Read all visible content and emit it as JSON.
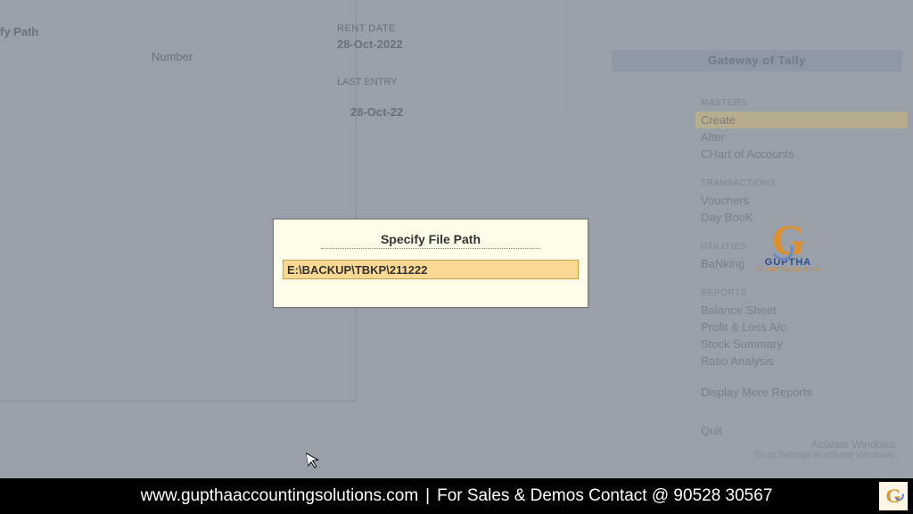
{
  "left": {
    "specify_path_label": "fy Path",
    "number_label": "Number"
  },
  "dates": {
    "current_label": "RENT DATE",
    "current_value": "28-Oct-2022",
    "entry_label": "LAST ENTRY",
    "entry_value": "28-Oct-22"
  },
  "sidebar": {
    "header": "Gateway of Tally",
    "sections": [
      {
        "title": "MASTERS",
        "items": [
          "Create",
          "Alter",
          "CHart of Accounts"
        ],
        "highlight_index": 0
      },
      {
        "title": "TRANSACTIONS",
        "items": [
          "Vouchers",
          "Day BooK"
        ]
      },
      {
        "title": "UTILITIES",
        "items": [
          "BaNking"
        ]
      },
      {
        "title": "REPORTS",
        "items": [
          "Balance Sheet",
          "Profit & Loss A/c",
          "Stock Summary",
          "Ratio Analysis"
        ]
      }
    ],
    "display_more": "Display More Reports",
    "quit": "Quit"
  },
  "activate": {
    "title": "Activate Windows",
    "sub": "Go to Settings to activate Windows."
  },
  "modal": {
    "title": "Specify File Path",
    "value": "E:\\BACKUP\\TBKP\\211222"
  },
  "logo": {
    "brand": "GUPTHA",
    "sub": "ACCOUNTING SOLUTIONS"
  },
  "footer": {
    "website": "www.gupthaaccountingsolutions.com",
    "text": "For Sales & Demos Contact @ 90528 30567"
  }
}
